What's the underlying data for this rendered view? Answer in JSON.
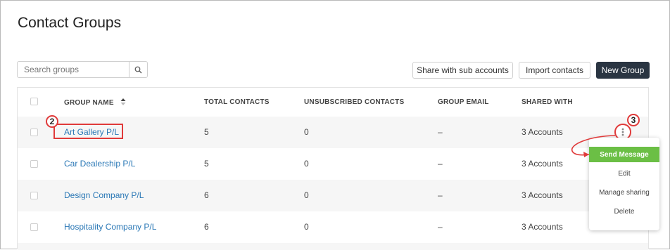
{
  "page": {
    "title": "Contact Groups"
  },
  "search": {
    "placeholder": "Search groups",
    "icon": "search-icon"
  },
  "toolbar": {
    "share_label": "Share with sub accounts",
    "import_label": "Import contacts",
    "new_group_label": "New Group"
  },
  "table": {
    "columns": {
      "group_name": "GROUP NAME",
      "total_contacts": "TOTAL CONTACTS",
      "unsubscribed": "UNSUBSCRIBED CONTACTS",
      "group_email": "GROUP EMAIL",
      "shared_with": "SHARED WITH"
    },
    "rows": [
      {
        "name": "Art Gallery P/L",
        "total": "5",
        "unsubscribed": "0",
        "email": "–",
        "shared": "3 Accounts"
      },
      {
        "name": "Car Dealership P/L",
        "total": "5",
        "unsubscribed": "0",
        "email": "–",
        "shared": "3 Accounts"
      },
      {
        "name": "Design Company P/L",
        "total": "6",
        "unsubscribed": "0",
        "email": "–",
        "shared": "3 Accounts"
      },
      {
        "name": "Hospitality Company P/L",
        "total": "6",
        "unsubscribed": "0",
        "email": "–",
        "shared": "3 Accounts"
      }
    ]
  },
  "row_menu": {
    "items": [
      "Send Message",
      "Edit",
      "Manage sharing",
      "Delete"
    ]
  },
  "annotations": {
    "marker_2": "2",
    "marker_3": "3"
  },
  "colors": {
    "link": "#2b78b6",
    "primary_button": "#2a3542",
    "menu_active": "#6bbf45",
    "annotation": "#e03a3a"
  }
}
